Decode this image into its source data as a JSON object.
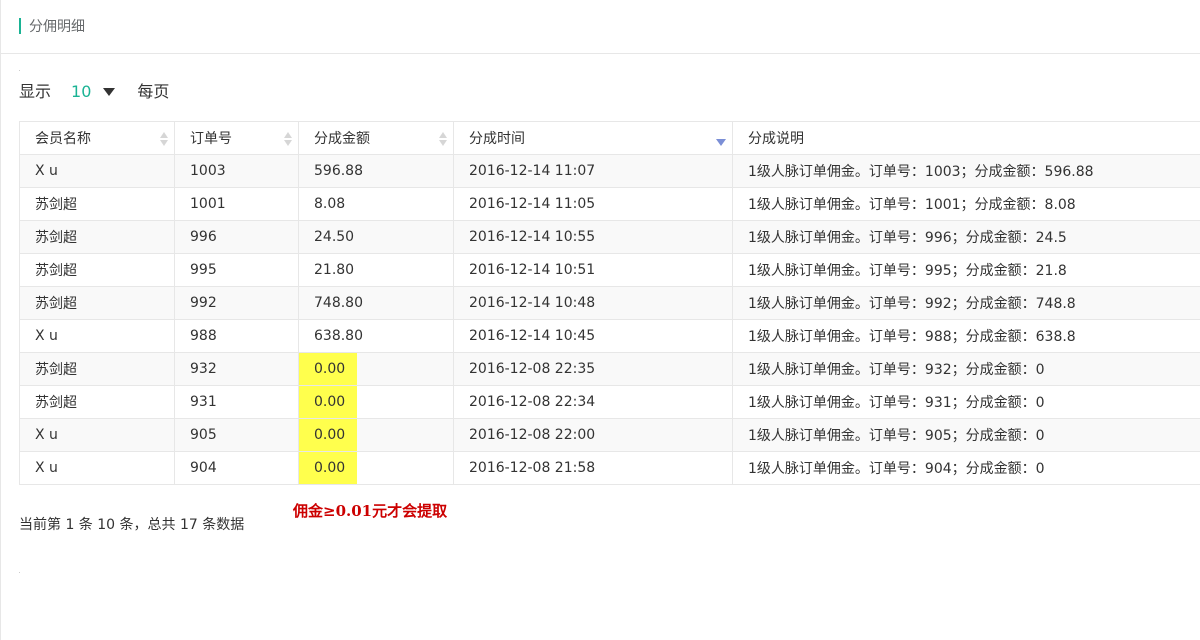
{
  "page": {
    "title": "分佣明细"
  },
  "length_menu": {
    "prefix": "显示",
    "value": "10",
    "suffix": "每页"
  },
  "table": {
    "columns": [
      "会员名称",
      "订单号",
      "分成金额",
      "分成时间",
      "分成说明"
    ],
    "rows": [
      [
        "X u",
        "1003",
        "596.88",
        "2016-12-14 11:07",
        "1级人脉订单佣金。订单号：1003；分成金额：596.88"
      ],
      [
        "苏剑超",
        "1001",
        "8.08",
        "2016-12-14 11:05",
        "1级人脉订单佣金。订单号：1001；分成金额：8.08"
      ],
      [
        "苏剑超",
        "996",
        "24.50",
        "2016-12-14 10:55",
        "1级人脉订单佣金。订单号：996；分成金额：24.5"
      ],
      [
        "苏剑超",
        "995",
        "21.80",
        "2016-12-14 10:51",
        "1级人脉订单佣金。订单号：995；分成金额：21.8"
      ],
      [
        "苏剑超",
        "992",
        "748.80",
        "2016-12-14 10:48",
        "1级人脉订单佣金。订单号：992；分成金额：748.8"
      ],
      [
        "X u",
        "988",
        "638.80",
        "2016-12-14 10:45",
        "1级人脉订单佣金。订单号：988；分成金额：638.8"
      ],
      [
        "苏剑超",
        "932",
        "0.00",
        "2016-12-08 22:35",
        "1级人脉订单佣金。订单号：932；分成金额：0"
      ],
      [
        "苏剑超",
        "931",
        "0.00",
        "2016-12-08 22:34",
        "1级人脉订单佣金。订单号：931；分成金额：0"
      ],
      [
        "X u",
        "905",
        "0.00",
        "2016-12-08 22:00",
        "1级人脉订单佣金。订单号：905；分成金额：0"
      ],
      [
        "X u",
        "904",
        "0.00",
        "2016-12-08 21:58",
        "1级人脉订单佣金。订单号：904；分成金额：0"
      ]
    ]
  },
  "info_text": "当前第 1 条 10 条，总共 17 条数据",
  "annotation": "佣金≥0.01元才会提取",
  "colors": {
    "accent": "#1ab394",
    "highlight": "#ffff4d",
    "annotation": "#cc0000",
    "sort_active": "#7b8fd6"
  }
}
